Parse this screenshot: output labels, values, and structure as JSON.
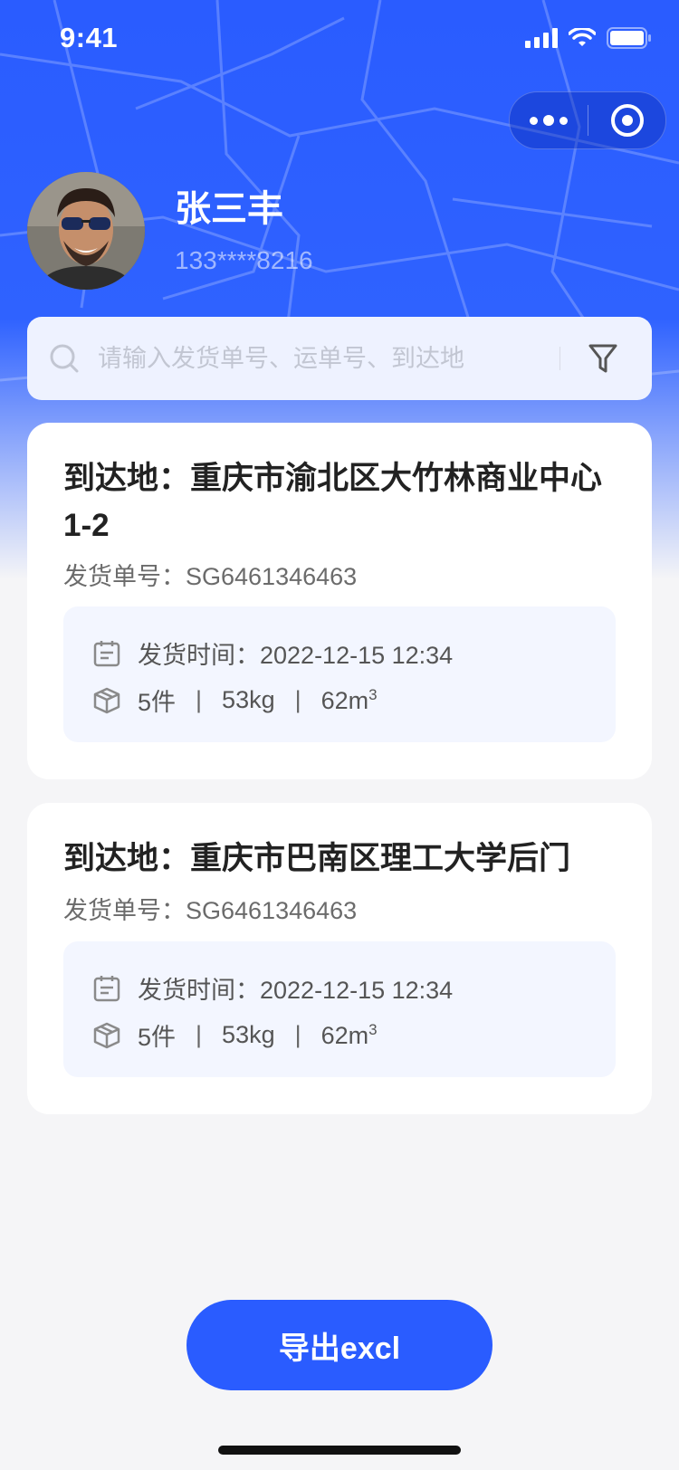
{
  "status_bar": {
    "time": "9:41"
  },
  "user": {
    "name": "张三丰",
    "phone": "133****8216"
  },
  "search": {
    "placeholder": "请输入发货单号、运单号、到达地"
  },
  "cards": [
    {
      "title": "到达地：重庆市渝北区大竹林商业中心1-2",
      "order": "发货单号：SG6461346463",
      "ship_time": "发货时间：2022-12-15 12:34",
      "pieces": "5件",
      "weight": "53kg",
      "volume": "62m",
      "volume_sup": "3",
      "sep": "|"
    },
    {
      "title": "到达地：重庆市巴南区理工大学后门",
      "order": "发货单号：SG6461346463",
      "ship_time": "发货时间：2022-12-15 12:34",
      "pieces": "5件",
      "weight": "53kg",
      "volume": "62m",
      "volume_sup": "3",
      "sep": "|"
    }
  ],
  "export_button": {
    "label": "导出excl"
  },
  "colors": {
    "primary": "#2a5cff",
    "card_info_bg": "#f3f6ff",
    "page_bg": "#f5f5f7"
  },
  "icons": [
    "signal-icon",
    "wifi-icon",
    "battery-icon",
    "more-icon",
    "target-icon",
    "search-icon",
    "filter-icon",
    "calendar-icon",
    "box-icon"
  ]
}
